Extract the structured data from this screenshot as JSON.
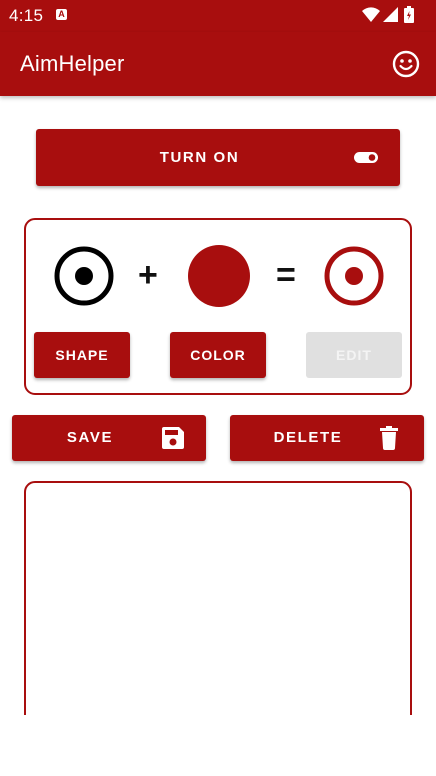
{
  "status_bar": {
    "time": "4:15",
    "app_icon_letter": "A",
    "icons": [
      "wifi-icon",
      "signal-icon",
      "battery-icon"
    ]
  },
  "app_bar": {
    "title": "AimHelper",
    "action_icon": "smile-icon"
  },
  "toggle": {
    "label": "TURN ON",
    "icon": "toggle-icon"
  },
  "preview": {
    "shape_icon": "target-shape-icon",
    "plus": "+",
    "color_icon": "color-dot",
    "equals": "=",
    "result_icon": "target-result-icon",
    "shape_button": "SHAPE",
    "color_button": "COLOR",
    "edit_button": "EDIT"
  },
  "actions": {
    "save_label": "SAVE",
    "save_icon": "save-icon",
    "delete_label": "DELETE",
    "delete_icon": "trash-icon"
  },
  "colors": {
    "primary": "#a80e0e",
    "disabled": "#e0e0e0"
  }
}
